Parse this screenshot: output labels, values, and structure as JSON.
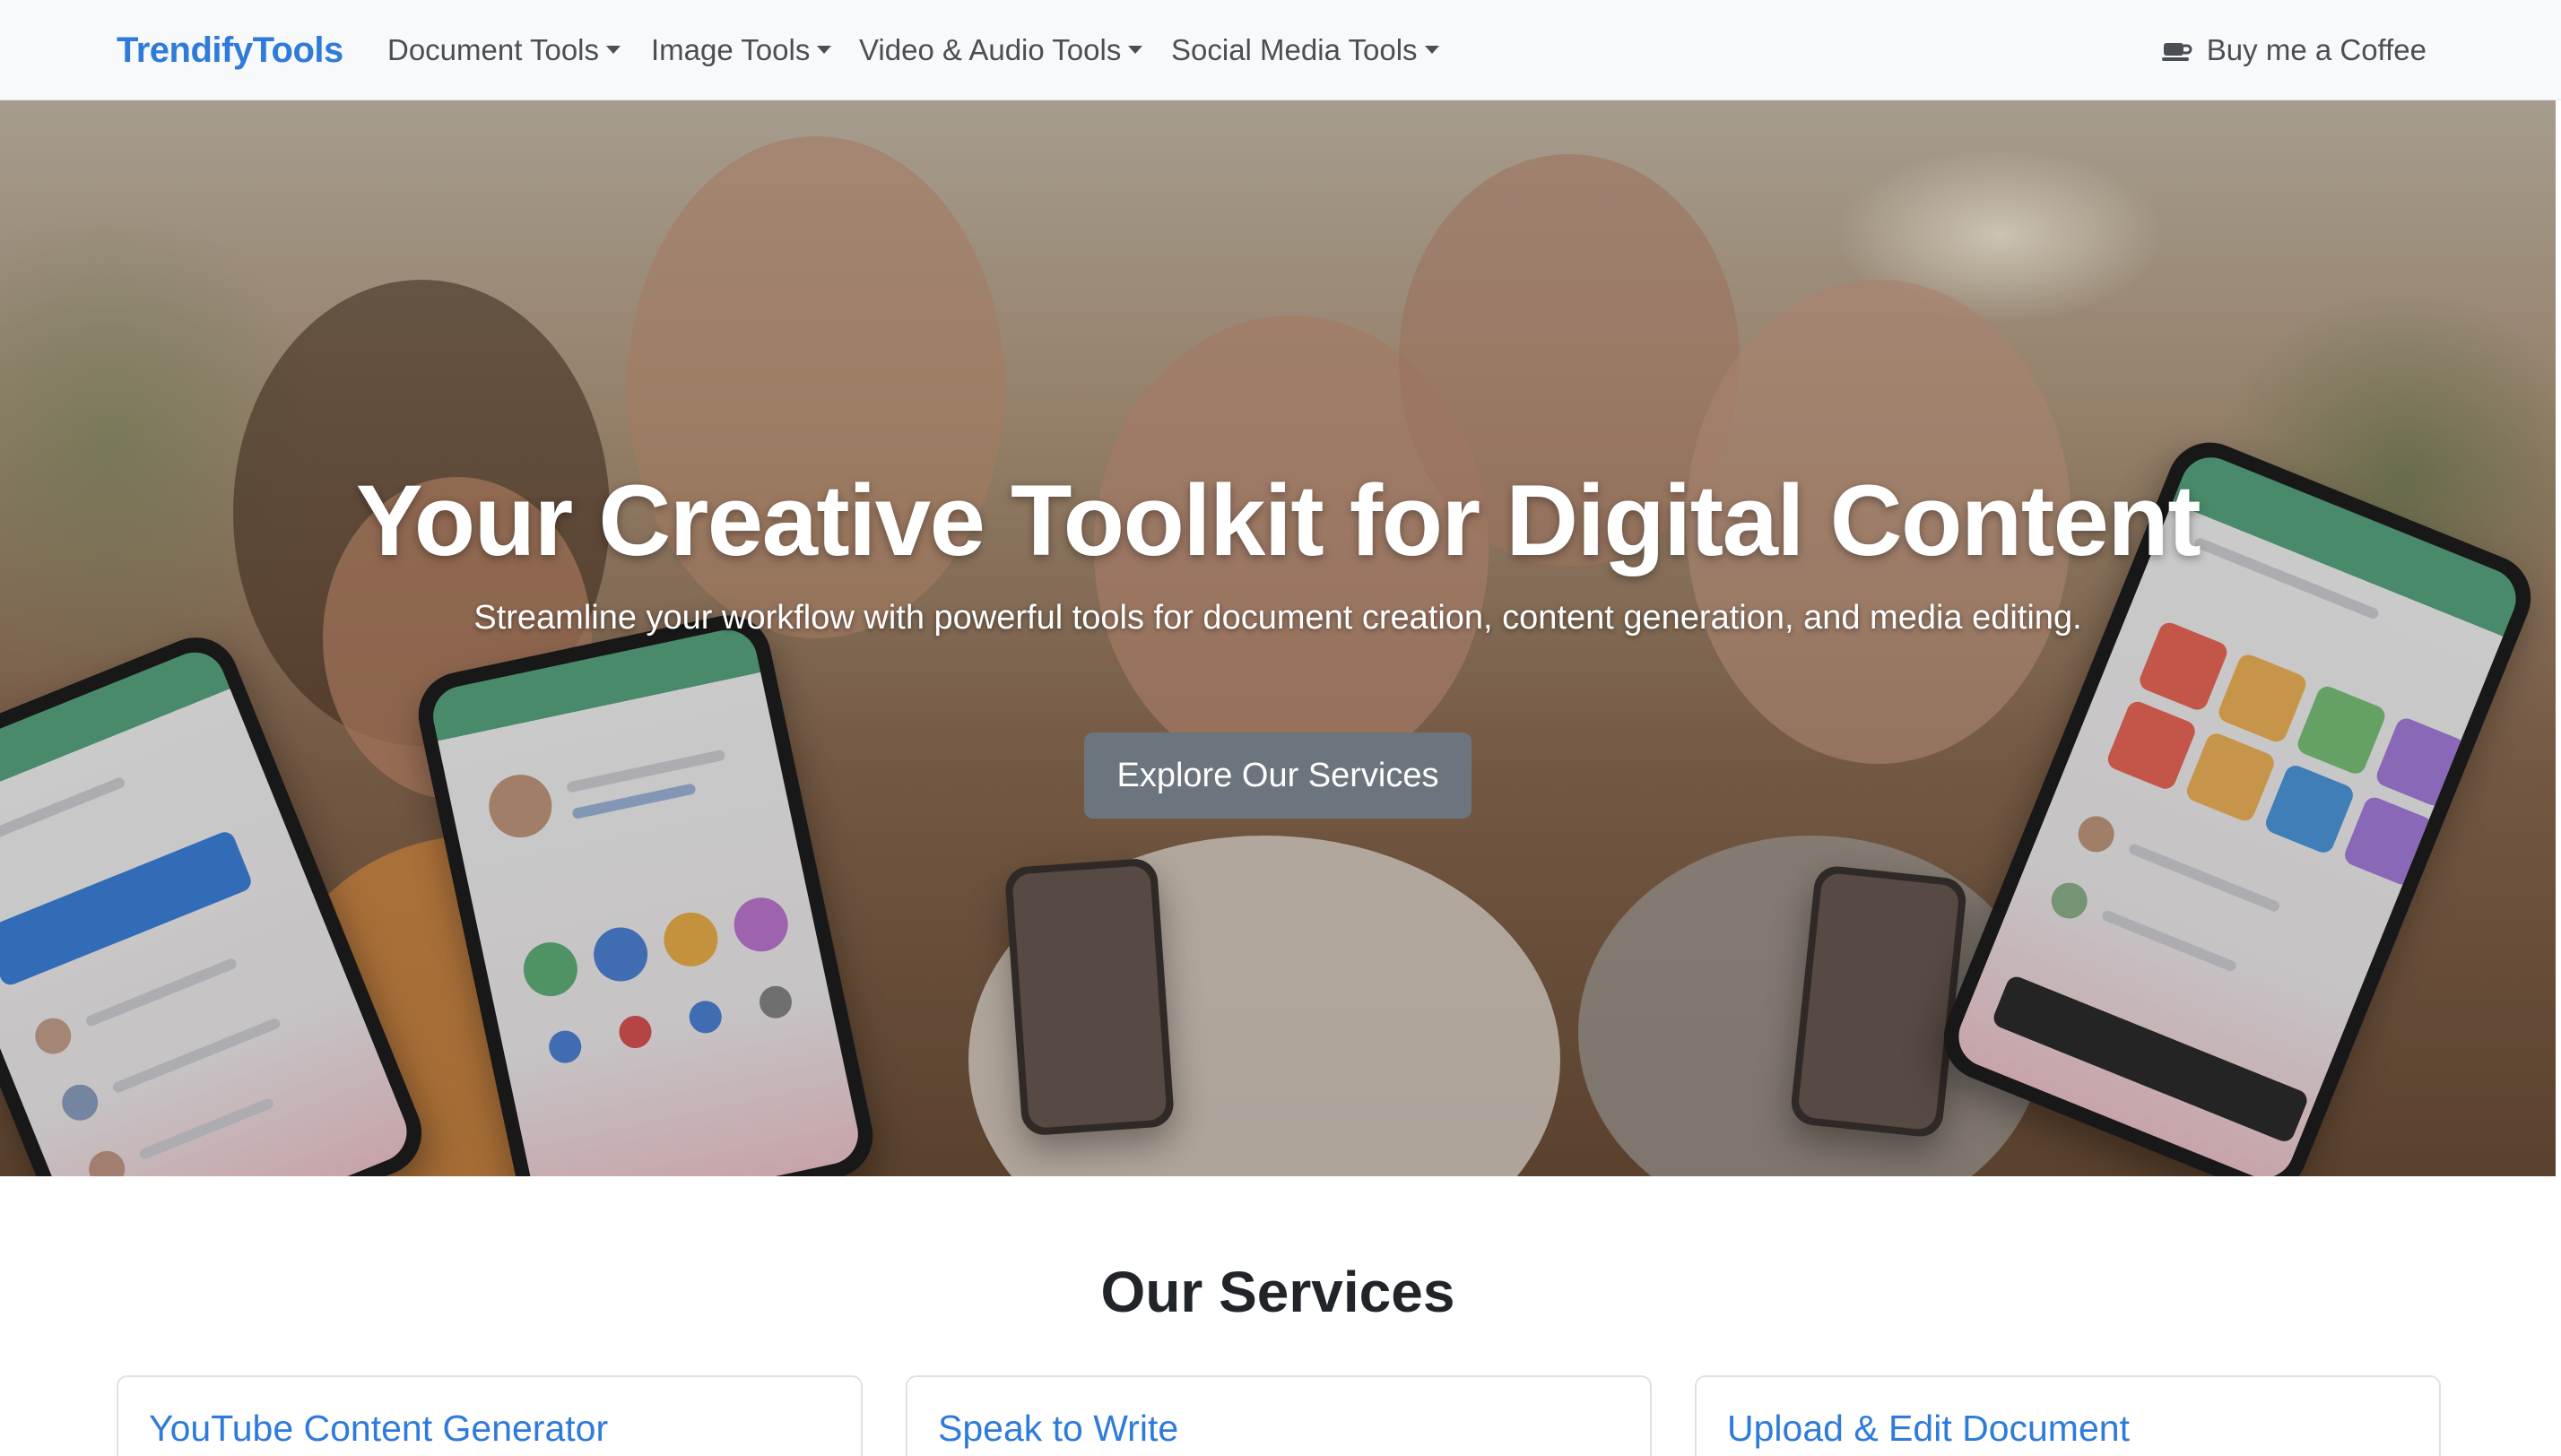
{
  "navbar": {
    "brand": "TrendifyTools",
    "menus": [
      {
        "label": "Document Tools"
      },
      {
        "label": "Image Tools"
      },
      {
        "label": "Video & Audio Tools"
      },
      {
        "label": "Social Media Tools"
      }
    ],
    "coffee": {
      "label": "Buy me a Coffee",
      "icon": "coffee-cup-icon"
    }
  },
  "hero": {
    "title": "Your Creative Toolkit for Digital Content",
    "subtitle": "Streamline your workflow with powerful tools for document creation, content generation, and media editing.",
    "button_label": "Explore Our Services"
  },
  "services": {
    "title": "Our Services",
    "cards": [
      {
        "title": "YouTube Content Generator"
      },
      {
        "title": "Speak to Write"
      },
      {
        "title": "Upload & Edit Document"
      }
    ]
  },
  "colors": {
    "brand": "#2f7bd9",
    "navbar_bg": "#f8f9fa",
    "hero_button_bg": "#6c757d",
    "card_title": "#2f7bd9"
  }
}
